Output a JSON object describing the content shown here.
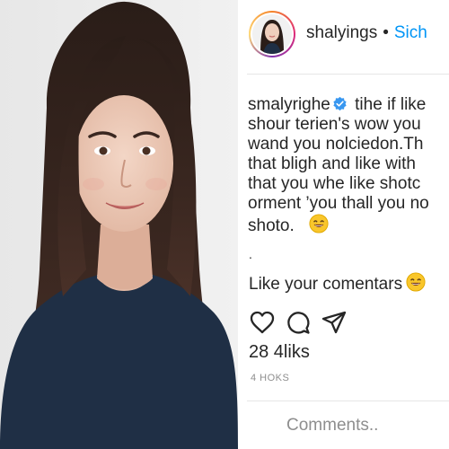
{
  "post": {
    "username": "shalyings",
    "separator": "•",
    "follow_label": "Sich",
    "caption": {
      "username": "smalyrighe",
      "first_line_text": " tihe if like",
      "lines": [
        "shour terien's wow you",
        "wand you nolciedon.Th",
        "that bligh and like with",
        "that you whe like shotc",
        "orment ’you thall you no"
      ],
      "last_line_text": "shoto."
    },
    "bullet": ".",
    "comment_text": "Like your comentars",
    "likes_text": "28 4liks",
    "timestamp": "4 HOKS",
    "comment_placeholder": "Comments.."
  },
  "icons": {
    "heart": "heart-icon",
    "comment": "comment-icon",
    "share": "share-icon",
    "verified": "verified-badge-icon",
    "emoji": "smiling-face-emoji"
  },
  "colors": {
    "text": "#262626",
    "follow": "#0095f6",
    "verified": "#3897f0",
    "secondary": "#8e8e8e",
    "emoji": "#f9c62b"
  }
}
